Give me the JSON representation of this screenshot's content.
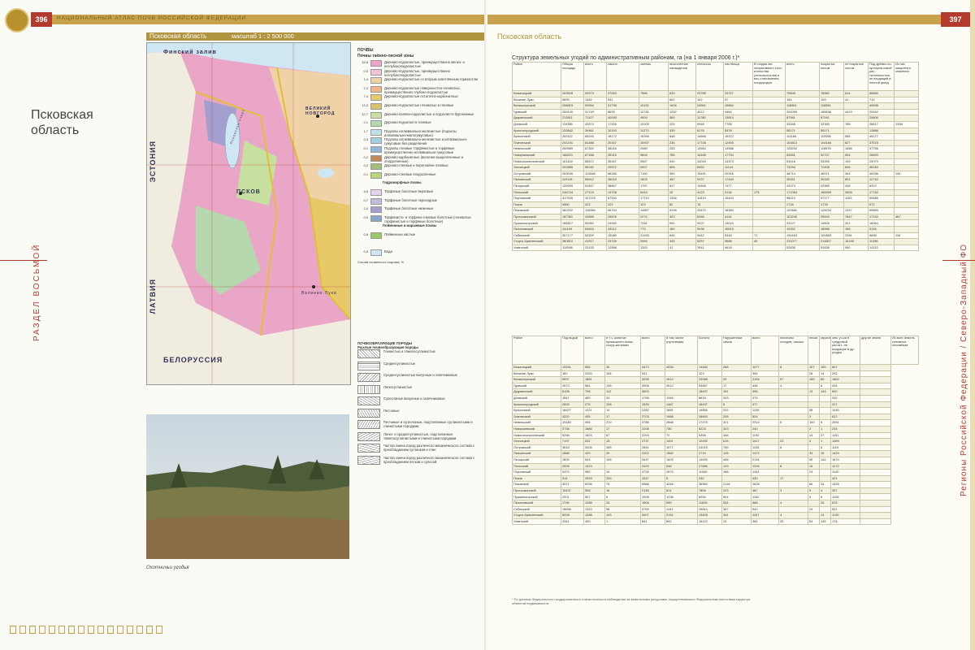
{
  "left": {
    "page_number": "396",
    "atlas_title": "НАЦИОНАЛЬНЫЙ АТЛАС ПОЧВ РОССИЙСКОЙ ФЕДЕРАЦИИ",
    "region_bar": "Псковская область",
    "scale": "масштаб 1 : 2 500 000",
    "big_title": "Псковская область",
    "side_text": "РАЗДЕЛ ВОСЬМОЙ",
    "map_labels": {
      "gulf": "Финский залив",
      "estonia": "ЭСТОНИЯ",
      "latvia": "ЛАТВИЯ",
      "belarus": "БЕЛОРУССИЯ",
      "pskov": "ПСКОВ",
      "velikie_luki": "Великие Луки",
      "lake": "Псковское озеро",
      "velikiy_novgorod": "ВЕЛИКИЙ НОВГОРОД"
    },
    "legend_title": "ПОЧВЫ",
    "legend_sub": "Почвы таёжно-лесной зоны",
    "legend": [
      {
        "code": "33,8",
        "text": "Дерново-подзолистые, преимущественно мелко- и неглубокоподзолистые",
        "color": "#e9a6c6"
      },
      {
        "code": "0,5",
        "text": "Дерново-подзолистые, преимущественно неглубокоподзолистые",
        "color": "#f4c3d7"
      },
      {
        "code": "1,4",
        "text": "Дерново-подзолистые со вторым осветлённым горизонтом",
        "color": "#f0d2a8"
      },
      {
        "code": "2,2",
        "text": "Дерново-подзолистые поверхностно-глееватые, преимущественно глубоко-подзолистые",
        "color": "#f2b48a"
      },
      {
        "code": "7,4",
        "text": "Дерново-подзолистые остаточно-карбонатные",
        "color": "#e7c96a"
      },
      {
        "code": "13,3",
        "text": "Дерново-подзолистые глееватые и глеевые",
        "color": "#d7c36a"
      },
      {
        "code": "12,7",
        "text": "Дерново-палево-подзолистые и подзолисто-буроземные",
        "color": "#c7e0a0"
      },
      {
        "code": "2,1",
        "text": "Дерново-подзолисто-глеевые",
        "color": "#b5d8ae"
      },
      {
        "code": "1,7",
        "text": "Подзолы иллювиально-железистые (подзолы иллювиально-малогумусовые)",
        "color": "#bfe3e8"
      },
      {
        "code": "0,3",
        "text": "Подзолы иллювиально-железистые и иллювиально-гумусовые без разделения",
        "color": "#a5cfe0"
      },
      {
        "code": "0,1",
        "text": "Подзолы глеевые торфянистые и торфяные, преимущественно иллювиально-гумусовые",
        "color": "#8fb9d9"
      },
      {
        "code": "0,2",
        "text": "Дерново-карбонатные (включая выщелоченные и оподзоленные)",
        "color": "#c08a5a"
      },
      {
        "code": "0,2",
        "text": "Дерново-глеевые и перегнойно-глеевые",
        "color": "#9fbf7a"
      },
      {
        "code": "0,1",
        "text": "Дерново-глеевые оподзоленные",
        "color": "#b7d57a"
      },
      {
        "code": "",
        "text": "Гидроморфные почвы",
        "color": ""
      },
      {
        "code": "4,8",
        "text": "Торфяные болотные верховые",
        "color": "#e0d4ee"
      },
      {
        "code": "0,7",
        "text": "Торфяные болотные переходные",
        "color": "#c7b8de"
      },
      {
        "code": "2,4",
        "text": "Торфяные болотные низинные",
        "color": "#a3a0d0"
      },
      {
        "code": "0,9",
        "text": "Торфянисто- и торфяно-глеевые болотные (глееватые торфянистые и торфяные болотные)",
        "color": "#8aa7c9"
      },
      {
        "code": "",
        "text": "Пойменные и маршевые почвы",
        "color": ""
      },
      {
        "code": "0,6",
        "text": "Пойменные кислые",
        "color": "#9acb6a"
      },
      {
        "code": "",
        "text": "",
        "color": ""
      },
      {
        "code": "0,3",
        "text": "Вода",
        "color": "#cfe6f3"
      }
    ],
    "legend_note": "Состав почвенного покрова, %",
    "parent_title": "ПОЧВООБРАЗУЮЩИЕ ПОРОДЫ",
    "parent_sub": "Рыхлые почвообразующие породы",
    "parents": [
      "Глинистые и тяжелосуглинистые",
      "Среднесуглинистые",
      "Среднесуглинистые валунные и галечниковые",
      "Легкосуглинистые",
      "Супесчаные валунные и галечниковые",
      "Песчаные",
      "Песчаные и супесчаные, подстиланные суглинистыми и глинистыми породами",
      "Легко- и среднесуглинистые, подстиланные тяжелосуглинистыми и глинистыми породами",
      "Частая смена пород различного механического состава с преобладанием суглинков и глин",
      "Частая смена пород различного механического состава с преобладанием песков и супесей"
    ],
    "photo_caption": "Охотничьи угодья"
  },
  "right": {
    "page_number": "397",
    "region_bar": "Псковская область",
    "side_text": "Регионы Российской Федерации / Северо-Западный ФО",
    "table_title": "Структура земельных угодий по административным районам, га (на 1 января 2006 г.)*",
    "t1_headers": [
      "Район",
      "Общая площадь",
      "всего",
      "пашня",
      "залежь",
      "многолетние насаждения",
      "сенокосы",
      "пастбища",
      "В стадии ме-лиоративного стро-ительства (сельскохоз-ва) и вос-становления плодородия",
      "всего",
      "покрытые лесом",
      "не покрытые лесом",
      "Под древес-но-кустарни-ковой рас-тительностью, не входящей в лесной фонд",
      "Из них защитного значения"
    ],
    "t1_group": {
      "agri": "Сельскохозяйственные угодья",
      "incl": "в том числе",
      "forest": "Лесные земли",
      "incl2": "в том числе"
    },
    "t1_rows": [
      [
        "Бежаницкий",
        "263528",
        "92973",
        "37063",
        "7565",
        "633",
        "23785",
        "23727",
        "",
        "79606",
        "78982",
        "614",
        "86682",
        ""
      ],
      [
        "Великие Луки",
        "5699",
        "1482",
        "541",
        "",
        "662",
        "102",
        "97",
        "",
        "154",
        "153",
        "41",
        "710",
        ""
      ],
      [
        "Великолукский",
        "296819",
        "90554",
        "31798",
        "12431",
        "1904",
        "24561",
        "19854",
        "",
        "116551",
        "116551",
        "",
        "49638",
        ""
      ],
      [
        "Гдовский",
        "259140",
        "31749",
        "8625",
        "12781",
        "1252",
        "4012",
        "4464",
        "",
        "204055",
        "185636",
        "4419",
        "20642",
        ""
      ],
      [
        "Дедовичский",
        "213811",
        "71107",
        "40095",
        "4909",
        "589",
        "11780",
        "13814",
        "",
        "87941",
        "87941",
        "",
        "29806",
        ""
      ],
      [
        "Дновский",
        "119386",
        "40874",
        "17926",
        "12009",
        "225",
        "6946",
        "7768",
        "",
        "33168",
        "32383",
        "785",
        "28617",
        "1338"
      ],
      [
        "Красногородский",
        "133842",
        "39461",
        "10193",
        "11273",
        "339",
        "6178",
        "5478",
        "",
        "55171",
        "55171",
        "",
        "13886",
        ""
      ],
      [
        "Куньинский",
        "262112",
        "65243",
        "18172",
        "16394",
        "648",
        "14656",
        "15372",
        "",
        "111180",
        "110596",
        "584",
        "49177",
        ""
      ],
      [
        "Локнянский",
        "241241",
        "81488",
        "20167",
        "10937",
        "235",
        "17745",
        "12405",
        "",
        "104813",
        "104186",
        "627",
        "37578",
        ""
      ],
      [
        "Невельский",
        "269989",
        "67302",
        "38016",
        "2989",
        "255",
        "12654",
        "13988",
        "",
        "128232",
        "118576",
        "1656",
        "37756",
        ""
      ],
      [
        "Новоржевский",
        "168201",
        "87166",
        "28315",
        "9604",
        "785",
        "16185",
        "17754",
        "",
        "53281",
        "52747",
        "534",
        "26829",
        ""
      ],
      [
        "Новосокольнический",
        "161832",
        "85672",
        "35167",
        "9567",
        "549",
        "10016",
        "14373",
        "",
        "53418",
        "53269",
        "149",
        "29079",
        ""
      ],
      [
        "Опочецкий",
        "202885",
        "56340",
        "29572",
        "5907",
        "665",
        "8452",
        "11144",
        "",
        "73254",
        "72408",
        "846",
        "48180",
        ""
      ],
      [
        "Островский",
        "263036",
        "113848",
        "68265",
        "7160",
        "350",
        "15491",
        "20318",
        "",
        "48714",
        "48371",
        "343",
        "46256",
        "194"
      ],
      [
        "Палкинский",
        "119116",
        "65612",
        "38024",
        "1803",
        "487",
        "9237",
        "17444",
        "",
        "30921",
        "30320",
        "601",
        "12742",
        ""
      ],
      [
        "Печорский",
        "125099",
        "51657",
        "38807",
        "1787",
        "627",
        "10845",
        "7477",
        "",
        "43373",
        "42965",
        "408",
        "8319",
        ""
      ],
      [
        "Плюсский",
        "246744",
        "27124",
        "13708",
        "6443",
        "25",
        "4123",
        "2134",
        "175",
        "171064",
        "168459",
        "2605",
        "17782",
        ""
      ],
      [
        "Порховский",
        "317535",
        "107220",
        "67004",
        "17710",
        "1254",
        "11819",
        "15403",
        "",
        "98219",
        "97177",
        "1153",
        "59486",
        ""
      ],
      [
        "Псков",
        "9560",
        "422",
        "222",
        "123",
        "62",
        "15",
        "",
        "",
        "1718",
        "1718",
        "",
        "672",
        ""
      ],
      [
        "Псковский",
        "382202",
        "116084",
        "56744",
        "14857",
        "5198",
        "20470",
        "18364",
        "",
        "129481",
        "128234",
        "1247",
        "59683",
        ""
      ],
      [
        "Пустошкинский",
        "187381",
        "41655",
        "25876",
        "2274",
        "423",
        "8365",
        "4116",
        "",
        "103240",
        "95593",
        "7647",
        "17192",
        "467"
      ],
      [
        "Пушкиногорский",
        "185817",
        "55362",
        "24940",
        "7281",
        "590",
        "9207",
        "13024",
        "",
        "20127",
        "19805",
        "322",
        "18064",
        ""
      ],
      [
        "Пыталовский",
        "111109",
        "64816",
        "43212",
        "773",
        "180",
        "9938",
        "10813",
        "",
        "19162",
        "18986",
        "156",
        "5126",
        ""
      ],
      [
        "Себежский",
        "307177",
        "52509",
        "15089",
        "21495",
        "645",
        "9442",
        "5318",
        "71",
        "194163",
        "191883",
        "2281",
        "9698",
        "116"
      ],
      [
        "Струго-Красненский",
        "380810",
        "41517",
        "23745",
        "2084",
        "345",
        "8257",
        "5586",
        "40",
        "231077",
        "214807",
        "16198",
        "11356",
        ""
      ],
      [
        "Усвятский",
        "110598",
        "22433",
        "12568",
        "1263",
        "41",
        "3941",
        "4618",
        "",
        "52836",
        "51836",
        "980",
        "14113",
        ""
      ]
    ],
    "t2_headers": [
      "Район",
      "Под водой",
      "всего",
      "в т.ч. занятые промышлен-ными соору-жениями",
      "всего",
      "в том числе грунтовыми",
      "Болота",
      "Нарушенные земли",
      "всего",
      "полигоны отходов, свалки",
      "пески",
      "овраги",
      "зем. уч-ки в тундровой растит., не входящие в др. угодья",
      "другие земли",
      "Из всех земель сплавных леспмбаза"
    ],
    "t2_group": {
      "built": "Земли застройки",
      "roads": "Под дорогами",
      "other": "Прочие земли",
      "incl": "в том числе"
    },
    "t2_rows": [
      [
        "Бежаницкий",
        "13331",
        "555",
        "30",
        "4473",
        "4255",
        "14482",
        "258",
        "1077",
        "8",
        "107",
        "155",
        "807",
        ""
      ],
      [
        "Великие Луки",
        "182",
        "2253",
        "154",
        "531",
        "",
        "123",
        "",
        "394",
        "",
        "28",
        "14",
        "292",
        ""
      ],
      [
        "Великолукский",
        "5597",
        "1881",
        "",
        "3335",
        "1912",
        "23088",
        "20",
        "2154",
        "57",
        "155",
        "80",
        "1862",
        ""
      ],
      [
        "Гдовский",
        "4573",
        "584",
        "138",
        "3908",
        "3012",
        "54567",
        "17",
        "436",
        "4",
        "",
        "6",
        "426",
        ""
      ],
      [
        "Дедовичский",
        "6128",
        "798",
        "112",
        "3803",
        "",
        "18497",
        "151",
        "396",
        "",
        "13",
        "143",
        "640",
        ""
      ],
      [
        "Дновский",
        "1847",
        "480",
        "34",
        "1798",
        "1346",
        "8618",
        "343",
        "375",
        "",
        "",
        "",
        "315",
        ""
      ],
      [
        "Красногородский",
        "2805",
        "275",
        "208",
        "1525",
        "1467",
        "18437",
        "5",
        "377",
        "",
        "",
        "",
        "317",
        ""
      ],
      [
        "Куньинский",
        "16427",
        "1221",
        "14",
        "2282",
        "1881",
        "14666",
        "202",
        "1135",
        "",
        "98",
        "",
        "1045",
        ""
      ],
      [
        "Локнянский",
        "4220",
        "495",
        "17",
        "2703",
        "1988",
        "28893",
        "205",
        "824",
        "",
        "3",
        "",
        "822",
        ""
      ],
      [
        "Невельский",
        "19180",
        "995",
        "219",
        "3788",
        "2668",
        "17275",
        "321",
        "2314",
        "5",
        "153",
        "5",
        "2051",
        ""
      ],
      [
        "Новоржевский",
        "3738",
        "1884",
        "17",
        "2208",
        "736",
        "5223",
        "323",
        "240",
        "",
        "2",
        "1",
        "234",
        ""
      ],
      [
        "Новосокольнический",
        "5288",
        "1823",
        "87",
        "2293",
        "72",
        "5308",
        "446",
        "1192",
        "",
        "14",
        "27",
        "1151",
        ""
      ],
      [
        "Опочецкий",
        "7197",
        "632",
        "15",
        "2737",
        "1119",
        "12492",
        "615",
        "1417",
        "23",
        "4",
        "1",
        "1389",
        ""
      ],
      [
        "Островский",
        "3818",
        "3008",
        "365",
        "2891",
        "1977",
        "24915",
        "785",
        "1135",
        "8",
        "",
        "8",
        "1119",
        ""
      ],
      [
        "Палкинский",
        "2888",
        "429",
        "30",
        "2202",
        "1582",
        "2719",
        "128",
        "1472",
        "",
        "33",
        "15",
        "1424",
        ""
      ],
      [
        "Печорский",
        "1839",
        "543",
        "108",
        "2837",
        "1629",
        "13930",
        "408",
        "2115",
        "",
        "59",
        "142",
        "1874",
        ""
      ],
      [
        "Плюсский",
        "2508",
        "1413",
        "",
        "2429",
        "546",
        "27886",
        "129",
        "1294",
        "8",
        "14",
        "",
        "1272",
        ""
      ],
      [
        "Порховский",
        "5470",
        "989",
        "10",
        "4728",
        "2679",
        "11080",
        "188",
        "1163",
        "",
        "23",
        "",
        "1140",
        ""
      ],
      [
        "Псков",
        "414",
        "3929",
        "339",
        "1537",
        "5",
        "230",
        "",
        "430",
        "17",
        "",
        "",
        "421",
        ""
      ],
      [
        "Псковский",
        "4571",
        "6255",
        "79",
        "6588",
        "4246",
        "36950",
        "2116",
        "1626",
        "",
        "66",
        "34",
        "1526",
        ""
      ],
      [
        "Пустошкинский",
        "15437",
        "508",
        "16",
        "2145",
        "814",
        "7806",
        "203",
        "487",
        "3",
        "9",
        "4",
        "397",
        ""
      ],
      [
        "Пушкиногорский",
        "2201",
        "507",
        "6",
        "1908",
        "1238",
        "6254",
        "504",
        "1152",
        "",
        "3",
        "5",
        "1126",
        ""
      ],
      [
        "Пыталовский",
        "1796",
        "1288",
        "26",
        "1906",
        "595",
        "11899",
        "534",
        "888",
        "4",
        "",
        "26",
        "876",
        ""
      ],
      [
        "Себежский",
        "18656",
        "1420",
        "58",
        "3769",
        "1151",
        "26814",
        "357",
        "540",
        "",
        "24",
        "",
        "522",
        ""
      ],
      [
        "Струго-Красненский",
        "5208",
        "1288",
        "103",
        "3407",
        "2151",
        "13428",
        "341",
        "1157",
        "4",
        "",
        "14",
        "1139",
        ""
      ],
      [
        "Усвятский",
        "3341",
        "490",
        "1",
        "841",
        "692",
        "16122",
        "19",
        "384",
        "29",
        "54",
        "135",
        "176",
        ""
      ]
    ],
    "footnote": "* По данным Федерального государственного статистического наблюдения за земельными ресурсами, осуществляемого Федеральным агентством кадастра объектов недвижимости."
  }
}
